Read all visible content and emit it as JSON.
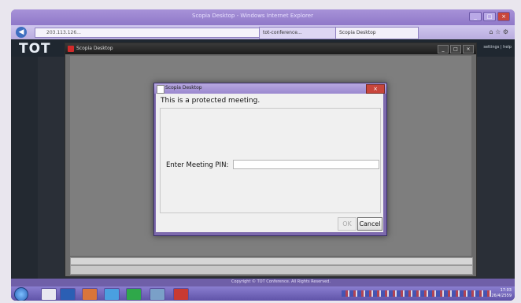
{
  "browser": {
    "window_title": "Scopia Desktop - Windows Internet Explorer",
    "address": "203.113.126...",
    "tabs": [
      "tot-conference...",
      "Scopia Desktop"
    ],
    "nav_right": "⌂ ☆ ⚙"
  },
  "page": {
    "logo": "TOT",
    "header_right": "settings | help",
    "footer": "Copyright © TOT Conference. All Rights Reserved."
  },
  "scopia_window": {
    "title": "Scopia Desktop",
    "controls": [
      "_",
      "□",
      "×"
    ]
  },
  "dialog": {
    "title": "Scopia Desktop",
    "close_symbol": "×",
    "heading": "This is a protected meeting.",
    "pin_label": "Enter Meeting PIN:",
    "pin_value": "",
    "ok_label": "OK",
    "cancel_label": "Cancel"
  },
  "taskbar": {
    "time": "17:03",
    "date": "26/4/2559"
  },
  "colors": {
    "dialog_frame": "#7d6aad",
    "cancel_border": "#707070",
    "close_red": "#c8463c"
  }
}
